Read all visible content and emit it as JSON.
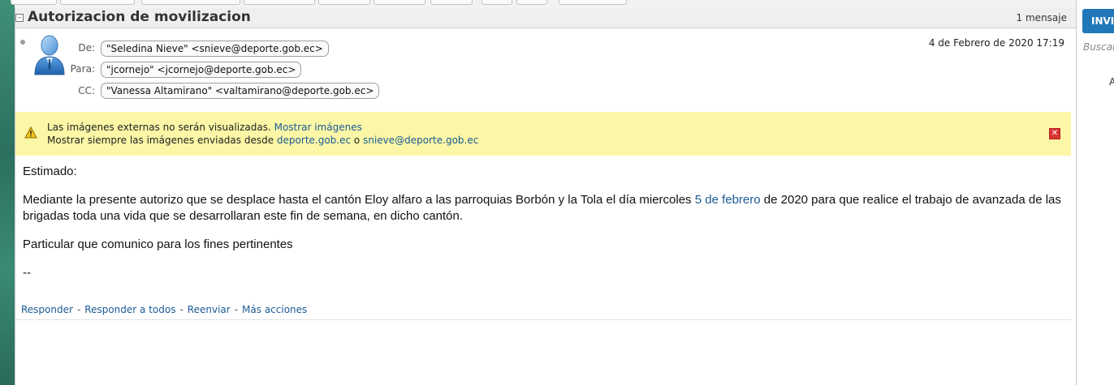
{
  "thread": {
    "title": "Autorizacion de movilizacion",
    "collapse_glyph": "–",
    "message_count": "1 mensaje"
  },
  "message": {
    "date": "4 de Febrero de 2020 17:19",
    "from_label": "De:",
    "from": "\"Seledina Nieve\" <snieve@deporte.gob.ec>",
    "to_label": "Para:",
    "to": "\"jcornejo\" <jcornejo@deporte.gob.ec>",
    "cc_label": "CC:",
    "cc": "\"Vanessa Altamirano\" <valtamirano@deporte.gob.ec>"
  },
  "notice": {
    "line1_text": "Las imágenes externas no serán visualizadas.",
    "line1_link": "Mostrar imágenes",
    "line2_text": "Mostrar siempre las imágenes enviadas desde",
    "line2_link1": "deporte.gob.ec",
    "line2_or": "o",
    "line2_link2": "snieve@deporte.gob.ec",
    "close_glyph": "✕"
  },
  "body": {
    "greeting": "Estimado:",
    "para1_before": "Mediante la presente autorizo que se desplace hasta el cantón Eloy alfaro a las parroquias Borbón y la Tola  el día miercoles ",
    "para1_link": "5 de febrero",
    "para1_after": " de 2020 para que realice el trabajo de avanzada de las brigadas toda una vida que se desarrollaran este fin de semana, en dicho cantón.",
    "para2": "Particular que comunico para los fines pertinentes",
    "signature": "--"
  },
  "actions": {
    "reply": "Responder",
    "reply_all": "Responder a todos",
    "forward": "Reenviar",
    "more": "Más acciones",
    "separator": "-"
  },
  "right_panel": {
    "invite_label": "INVI",
    "search_hint": "Buscar",
    "letter": "A"
  },
  "icons": {
    "avatar": "user-avatar-icon",
    "warning": "warning-triangle-icon",
    "close": "close-icon"
  },
  "colors": {
    "link": "#1a5a96",
    "notice_bg": "#fbf7a6",
    "invite_bg": "#2178b8",
    "close_red": "#d93535"
  }
}
